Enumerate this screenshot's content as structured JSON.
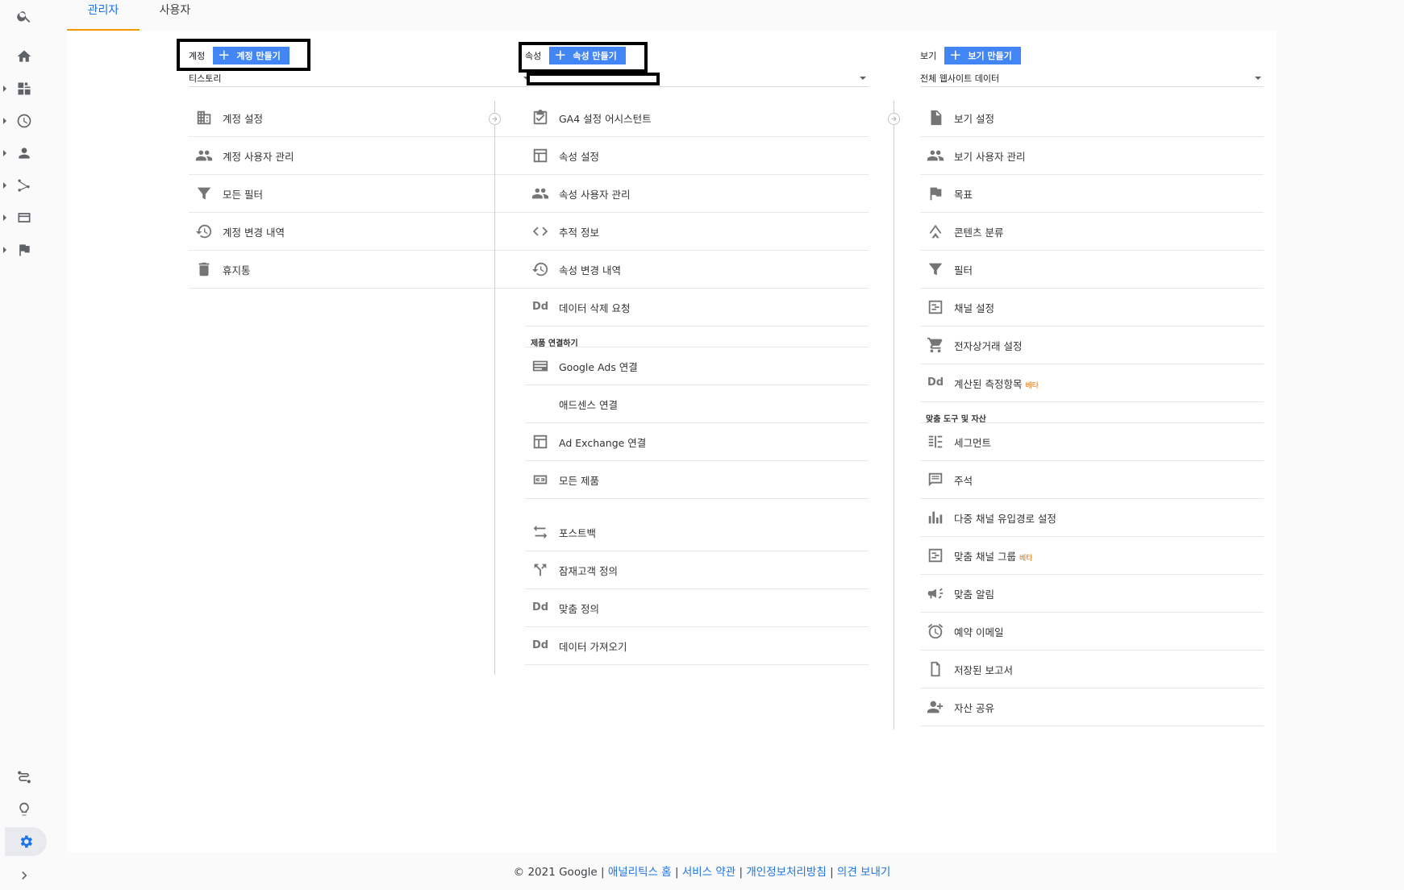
{
  "tabs": [
    {
      "label": "관리자"
    },
    {
      "label": "사용자"
    }
  ],
  "account": {
    "label": "계정",
    "create_label": "계정 만들기",
    "selected": "티스토리",
    "items": [
      {
        "label": "계정 설정",
        "icon": "building-icon"
      },
      {
        "label": "계정 사용자 관리",
        "icon": "people-icon"
      },
      {
        "label": "모든 필터",
        "icon": "filter-icon"
      },
      {
        "label": "계정 변경 내역",
        "icon": "history-icon"
      },
      {
        "label": "휴지통",
        "icon": "trash-icon"
      }
    ]
  },
  "property": {
    "label": "속성",
    "create_label": "속성 만들기",
    "selected": "",
    "items_top": [
      {
        "label": "GA4 설정 어시스턴트",
        "icon": "checklist-icon"
      },
      {
        "label": "속성 설정",
        "icon": "window-icon"
      },
      {
        "label": "속성 사용자 관리",
        "icon": "people-icon"
      },
      {
        "label": "추적 정보",
        "icon": "code-icon"
      },
      {
        "label": "속성 변경 내역",
        "icon": "history-icon"
      },
      {
        "label": "데이터 삭제 요청",
        "icon": "dd-icon"
      }
    ],
    "section_links": "제품 연결하기",
    "items_links": [
      {
        "label": "Google Ads 연결",
        "icon": "ads-icon"
      },
      {
        "label": "애드센스 연결",
        "icon": "none"
      },
      {
        "label": "Ad Exchange 연결",
        "icon": "window-icon"
      },
      {
        "label": "모든 제품",
        "icon": "link-icon"
      }
    ],
    "items_bottom": [
      {
        "label": "포스트백",
        "icon": "swap-icon"
      },
      {
        "label": "잠재고객 정의",
        "icon": "fork-icon"
      },
      {
        "label": "맞춤 정의",
        "icon": "dd-icon"
      },
      {
        "label": "데이터 가져오기",
        "icon": "dd-icon"
      }
    ]
  },
  "view": {
    "label": "보기",
    "create_label": "보기 만들기",
    "selected": "전체 웹사이트 데이터",
    "items_top": [
      {
        "label": "보기 설정",
        "icon": "document-icon"
      },
      {
        "label": "보기 사용자 관리",
        "icon": "people-icon"
      },
      {
        "label": "목표",
        "icon": "flag-icon"
      },
      {
        "label": "콘텐츠 분류",
        "icon": "person-run-icon"
      },
      {
        "label": "필터",
        "icon": "filter-icon"
      },
      {
        "label": "채널 설정",
        "icon": "channel-icon"
      },
      {
        "label": "전자상거래 설정",
        "icon": "cart-icon"
      },
      {
        "label": "계산된 측정항목",
        "icon": "dd-icon",
        "badge": "베타"
      }
    ],
    "section_tools": "맞춤 도구 및 자산",
    "items_tools": [
      {
        "label": "세그먼트",
        "icon": "segment-icon"
      },
      {
        "label": "주석",
        "icon": "comment-icon"
      },
      {
        "label": "다중 채널 유입경로 설정",
        "icon": "bars-icon"
      },
      {
        "label": "맞춤 채널 그룹",
        "icon": "channel-icon",
        "badge": "베타"
      },
      {
        "label": "맞춤 알림",
        "icon": "megaphone-icon"
      },
      {
        "label": "예약 이메일",
        "icon": "alarm-icon"
      },
      {
        "label": "저장된 보고서",
        "icon": "file-icon"
      },
      {
        "label": "자산 공유",
        "icon": "person-add-icon"
      }
    ]
  },
  "footer": {
    "copyright": "© 2021 Google",
    "sep": "|",
    "links": [
      "애널리틱스 홈",
      "서비스 약관",
      "개인정보처리방침",
      "의견 보내기"
    ]
  }
}
